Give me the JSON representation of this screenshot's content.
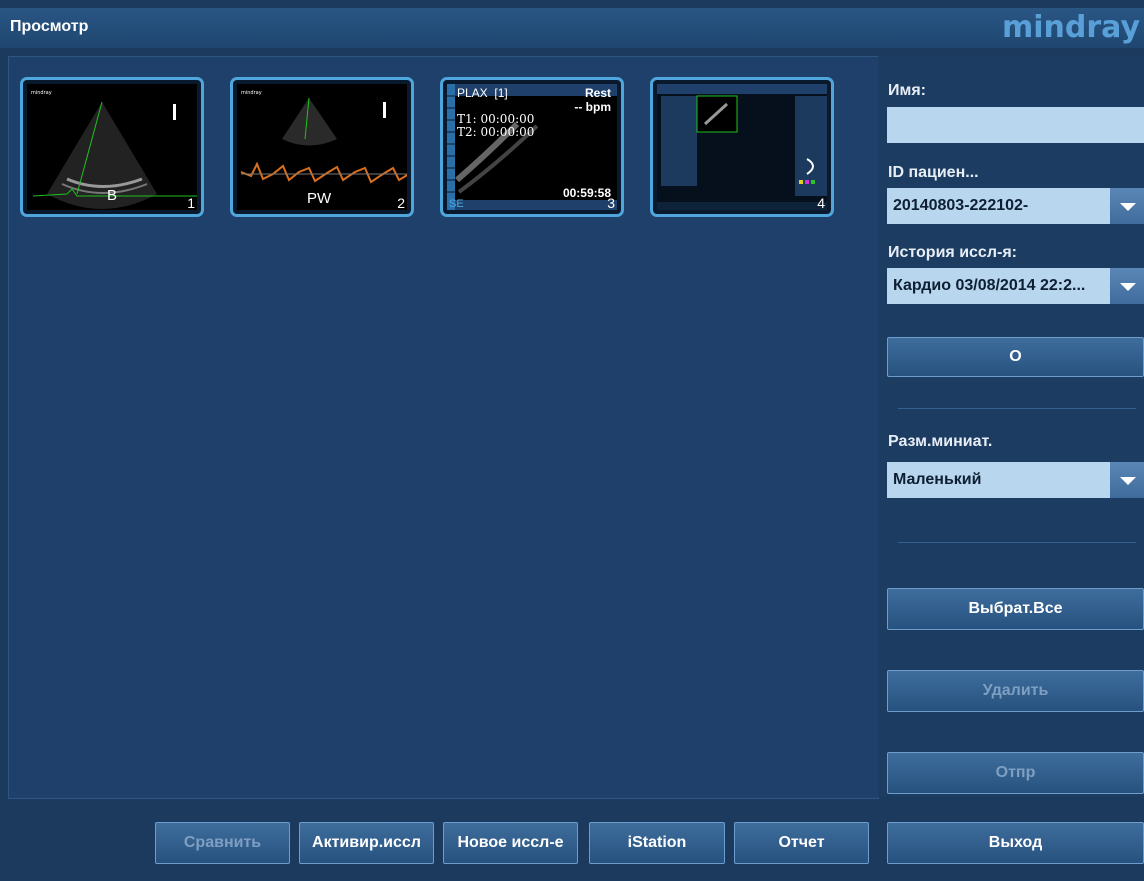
{
  "window": {
    "title": "Просмотр",
    "brand": "mindray"
  },
  "thumbnails": [
    {
      "mode": "B",
      "index": "1"
    },
    {
      "mode": "PW",
      "index": "2"
    },
    {
      "view": "PLAX",
      "view_index": "[1]",
      "state": "Rest",
      "hr": "-- bpm",
      "t1": "T1: 00:00:00",
      "t2": "T2: 00:00:00",
      "time": "00:59:58",
      "tag": "SE",
      "index": "3"
    },
    {
      "index": "4"
    }
  ],
  "side_panel": {
    "name_label": "Имя:",
    "name_value": "",
    "patient_id_label": "ID пациен...",
    "patient_id_value": "20140803-222102-",
    "history_label": "История иссл-я:",
    "history_value": "Кардио 03/08/2014 22:2...",
    "o_button": "O",
    "thumb_size_label": "Разм.миниат.",
    "thumb_size_value": "Маленький",
    "select_all_button": "Выбрат.Все",
    "delete_button": "Удалить",
    "send_button": "Отпр"
  },
  "bottom_bar": {
    "compare": "Сравнить",
    "activate": "Активир.иссл",
    "new_exam": "Новое иссл-е",
    "istation": "iStation",
    "report": "Отчет",
    "exit": "Выход"
  },
  "colors": {
    "accent": "#4ea6dc",
    "background": "#1b3a5e",
    "field": "#b9d6ef",
    "disabled_text": "#7f9fc2"
  }
}
